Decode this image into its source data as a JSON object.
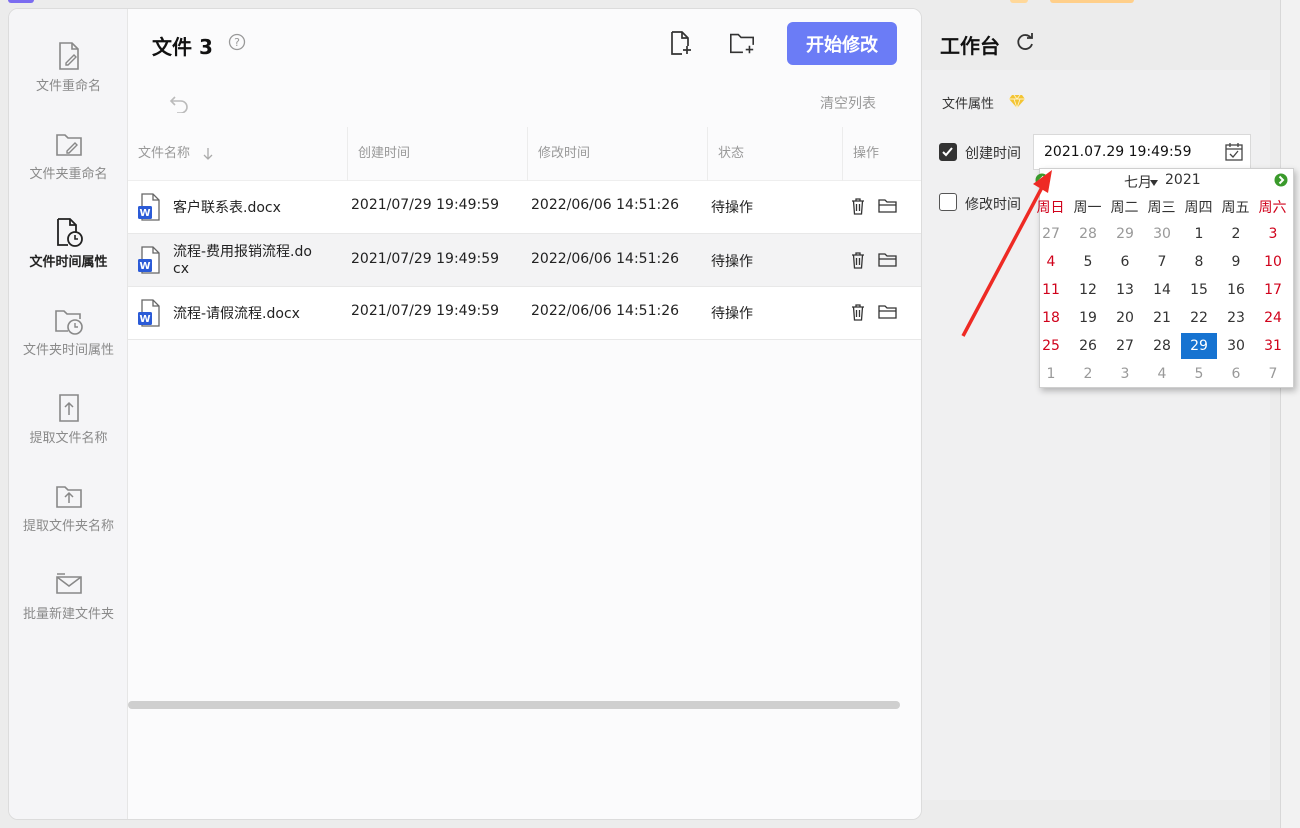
{
  "sidebar": {
    "items": [
      {
        "label": "文件重命名",
        "icon": "file-edit-icon"
      },
      {
        "label": "文件夹重命名",
        "icon": "folder-edit-icon"
      },
      {
        "label": "文件时间属性",
        "icon": "file-clock-icon",
        "active": true
      },
      {
        "label": "文件夹时间属性",
        "icon": "folder-clock-icon"
      },
      {
        "label": "提取文件名称",
        "icon": "file-upload-icon"
      },
      {
        "label": "提取文件夹名称",
        "icon": "folder-upload-icon"
      },
      {
        "label": "批量新建文件夹",
        "icon": "folder-mail-icon"
      }
    ]
  },
  "main": {
    "title": "文件 3",
    "start_button": "开始修改",
    "clear_list": "清空列表",
    "columns": [
      "文件名称",
      "创建时间",
      "修改时间",
      "状态",
      "操作"
    ],
    "rows": [
      {
        "name": "客户联系表.docx",
        "name2": "",
        "created": "2021/07/29 19:49:59",
        "modified": "2022/06/06 14:51:26",
        "status": "待操作"
      },
      {
        "name": "流程-费用报销流程.do",
        "name2": "cx",
        "created": "2021/07/29 19:49:59",
        "modified": "2022/06/06 14:51:26",
        "status": "待操作"
      },
      {
        "name": "流程-请假流程.docx",
        "name2": "",
        "created": "2021/07/29 19:49:59",
        "modified": "2022/06/06 14:51:26",
        "status": "待操作"
      }
    ]
  },
  "workspace": {
    "title": "工作台",
    "section_label": "文件属性",
    "created_label": "创建时间",
    "created_checked": true,
    "created_value": "2021.07.29 19:49:59",
    "modified_label": "修改时间",
    "modified_checked": false
  },
  "calendar": {
    "month": "七月",
    "year": "2021",
    "weekdays": [
      "周日",
      "周一",
      "周二",
      "周三",
      "周四",
      "周五",
      "周六"
    ],
    "weeks": [
      [
        "27",
        "28",
        "29",
        "30",
        "1",
        "2",
        "3"
      ],
      [
        "4",
        "5",
        "6",
        "7",
        "8",
        "9",
        "10"
      ],
      [
        "11",
        "12",
        "13",
        "14",
        "15",
        "16",
        "17"
      ],
      [
        "18",
        "19",
        "20",
        "21",
        "22",
        "23",
        "24"
      ],
      [
        "25",
        "26",
        "27",
        "28",
        "29",
        "30",
        "31"
      ],
      [
        "1",
        "2",
        "3",
        "4",
        "5",
        "6",
        "7"
      ]
    ],
    "selected": "29"
  },
  "colors": {
    "accent": "#6b7cf6",
    "selected_day": "#1673d1",
    "weekend_red": "#d0021b",
    "annotation_arrow": "#ee2a24",
    "word_blue": "#2b5bd7"
  }
}
